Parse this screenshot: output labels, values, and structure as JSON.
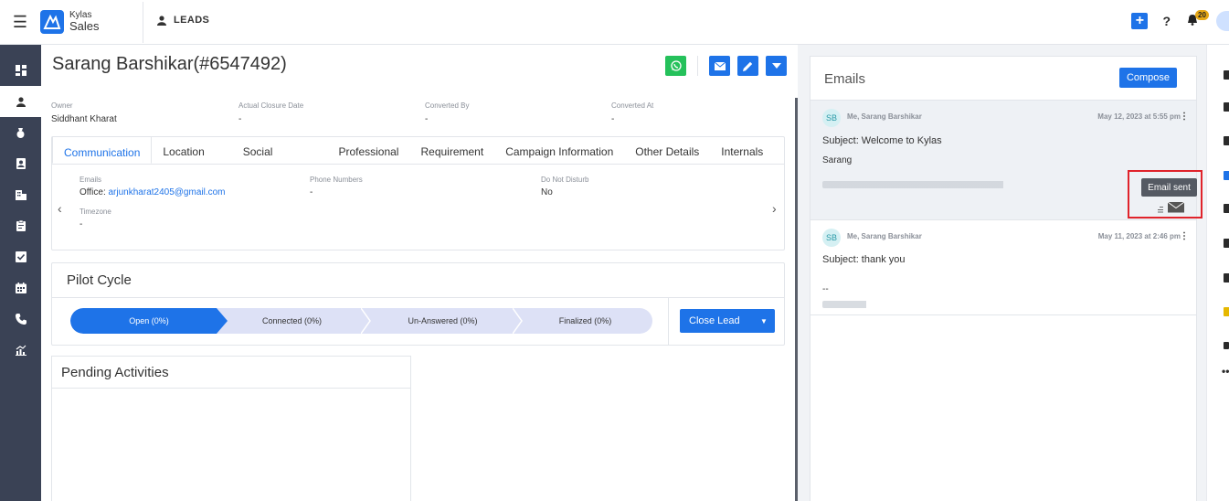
{
  "header": {
    "brand_small": "Kylas",
    "brand_big": "Sales",
    "module": "LEADS",
    "notification_count": "20"
  },
  "lead": {
    "title": "Sarang Barshikar(#6547492)",
    "meta": [
      {
        "label": "Owner",
        "value": "Siddhant Kharat"
      },
      {
        "label": "Actual Closure Date",
        "value": "-"
      },
      {
        "label": "Converted By",
        "value": "-"
      },
      {
        "label": "Converted At",
        "value": "-"
      }
    ]
  },
  "tabs": [
    "Communication",
    "Location",
    "Social",
    "Professional",
    "Requirement",
    "Campaign Information",
    "Other Details",
    "Internals"
  ],
  "communication": {
    "emails_label": "Emails",
    "emails_prefix": "Office: ",
    "emails_value": "arjunkharat2405@gmail.com",
    "phone_label": "Phone Numbers",
    "phone_value": "-",
    "dnd_label": "Do Not Disturb",
    "dnd_value": "No",
    "timezone_label": "Timezone",
    "timezone_value": "-"
  },
  "pilot": {
    "title": "Pilot Cycle",
    "stages": [
      "Open (0%)",
      "Connected (0%)",
      "Un-Answered (0%)",
      "Finalized (0%)"
    ],
    "close_label": "Close Lead"
  },
  "pending": {
    "title": "Pending Activities"
  },
  "emails": {
    "title": "Emails",
    "compose_label": "Compose",
    "items": [
      {
        "initials": "SB",
        "from": "Me, Sarang Barshikar",
        "date": "May 12, 2023 at 5:55 pm",
        "subject": "Subject: Welcome to Kylas",
        "line2": "Sarang"
      },
      {
        "initials": "SB",
        "from": "Me, Sarang Barshikar",
        "date": "May 11, 2023 at 2:46 pm",
        "subject": "Subject: thank you",
        "line2": "--"
      }
    ],
    "tooltip": "Email sent"
  },
  "colors": {
    "accent": "#1e73e8",
    "sidebar": "#3a4255",
    "whatsapp": "#25c15b",
    "highlight": "#e0232b"
  }
}
